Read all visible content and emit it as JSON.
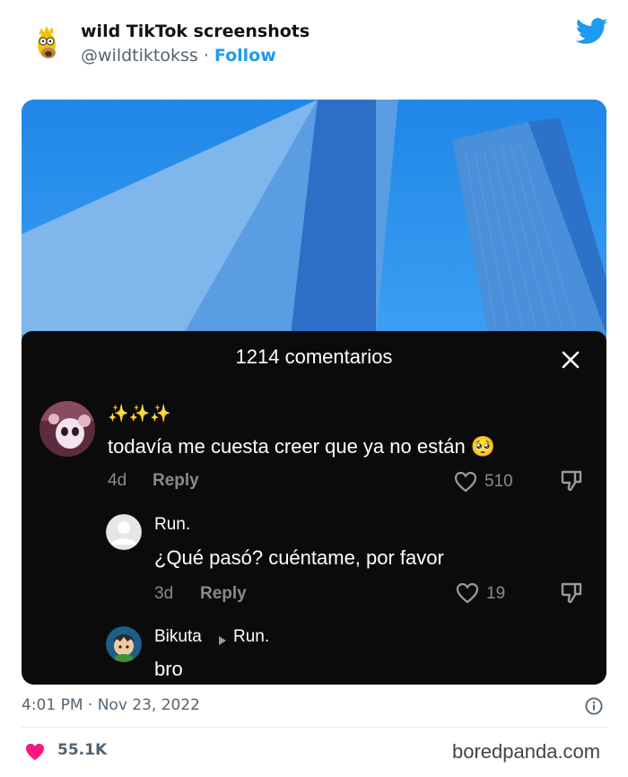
{
  "tweet": {
    "author_name": "wild TikTok screenshots",
    "handle": "@wildtiktokss",
    "separator": " · ",
    "follow_label": "Follow",
    "timestamp": "4:01 PM · Nov 23, 2022",
    "like_count": "55.1K",
    "brand_color": "#1d9bf0",
    "like_color": "#f91880"
  },
  "tiktok": {
    "comments_title": "1214 comentarios",
    "comments": [
      {
        "username": "✨✨✨",
        "text": "todavía me cuesta creer que ya no están 🥺",
        "age": "4d",
        "reply_label": "Reply",
        "likes": "510"
      },
      {
        "username": "Run.",
        "text": "¿Qué pasó? cuéntame, por favor",
        "age": "3d",
        "reply_label": "Reply",
        "likes": "19"
      },
      {
        "username": "Bikuta",
        "reply_to": "Run.",
        "text": "bro"
      }
    ]
  },
  "watermark": "boredpanda.com"
}
